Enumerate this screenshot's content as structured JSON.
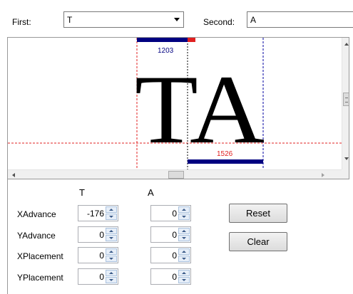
{
  "toolbar": {
    "first_label": "First:",
    "first_value": "T",
    "second_label": "Second:",
    "second_value": "A"
  },
  "preview": {
    "glyphs": "TA",
    "top_value": "1203",
    "bottom_value": "1526",
    "colors": {
      "guide_red": "#e02020",
      "guide_blue": "#0000a0",
      "bar_blue": "#000080",
      "bar_red": "#e02020"
    }
  },
  "panel": {
    "col_first": "T",
    "col_second": "A",
    "rows": [
      {
        "label": "XAdvance",
        "first": "-176",
        "second": "0"
      },
      {
        "label": "YAdvance",
        "first": "0",
        "second": "0"
      },
      {
        "label": "XPlacement",
        "first": "0",
        "second": "0"
      },
      {
        "label": "YPlacement",
        "first": "0",
        "second": "0"
      }
    ],
    "reset_label": "Reset",
    "clear_label": "Clear"
  }
}
